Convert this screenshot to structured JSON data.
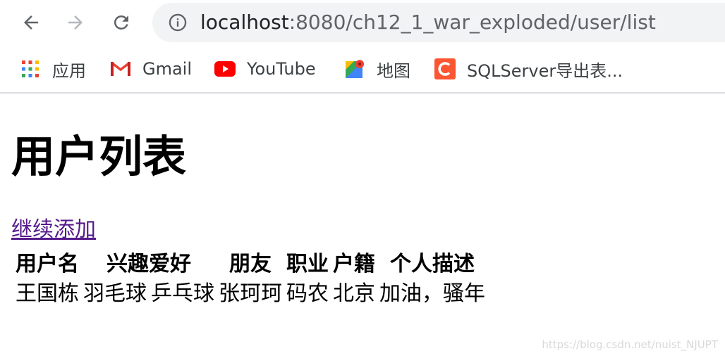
{
  "browser": {
    "url_host": "localhost",
    "url_rest": ":8080/ch12_1_war_exploded/user/list",
    "bookmarks": [
      {
        "label": "应用",
        "icon": "apps-grid-icon"
      },
      {
        "label": "Gmail",
        "icon": "gmail-icon"
      },
      {
        "label": "YouTube",
        "icon": "youtube-icon"
      },
      {
        "label": "地图",
        "icon": "maps-icon"
      },
      {
        "label": "SQLServer导出表...",
        "icon": "csdn-c-icon"
      }
    ]
  },
  "page": {
    "title": "用户列表",
    "add_link": "继续添加"
  },
  "table": {
    "headers": [
      "用户名",
      "兴趣爱好",
      "",
      "朋友",
      "职业",
      "户籍",
      "个人描述"
    ],
    "rows": [
      [
        "王国栋",
        "羽毛球",
        "乒乓球",
        "张珂珂",
        "码农",
        "北京",
        "加油，骚年"
      ]
    ]
  },
  "watermark": "https://blog.csdn.net/nuist_NJUPT",
  "colors": {
    "link_visited": "#551a8b",
    "omnibox_bg": "#f1f3f4",
    "youtube_red": "#ff0000",
    "csdn_orange": "#fc5531"
  }
}
